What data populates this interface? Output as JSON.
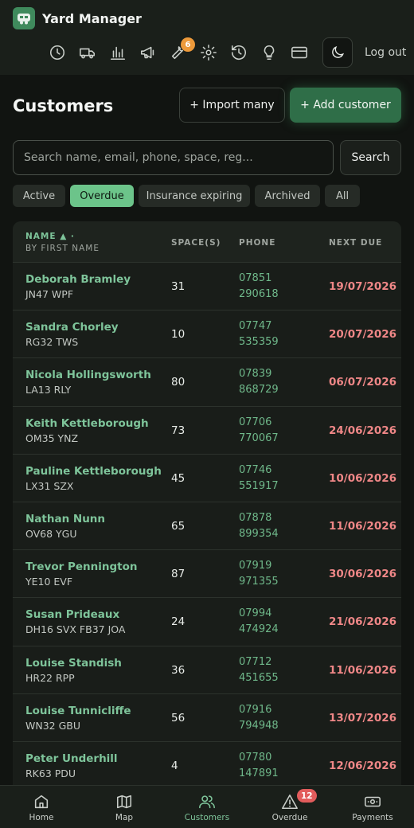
{
  "app": {
    "title": "Yard Manager"
  },
  "toolbar": {
    "icons": [
      "clock-icon",
      "truck-icon",
      "bar-chart-icon",
      "megaphone-icon",
      "wrench-icon",
      "gear-icon",
      "history-icon",
      "lightbulb-icon",
      "card-icon"
    ],
    "maintenance_badge": "6",
    "theme_icon": "moon-icon",
    "logout_label": "Log out"
  },
  "page": {
    "title": "Customers",
    "import_label": "+ Import many",
    "add_label": "+ Add customer"
  },
  "search": {
    "placeholder": "Search name, email, phone, space, reg...",
    "value": "",
    "button_label": "Search"
  },
  "filters": [
    {
      "label": "Active",
      "active": false
    },
    {
      "label": "Overdue",
      "active": true
    },
    {
      "label": "Insurance expiring",
      "active": false
    },
    {
      "label": "Archived",
      "active": false
    },
    {
      "label": "All",
      "active": false
    }
  ],
  "table": {
    "headers": {
      "name": "NAME ▲ ·",
      "name_sub": "BY FIRST NAME",
      "spaces": "SPACE(S)",
      "phone": "PHONE",
      "next_due": "NEXT DUE"
    },
    "rows": [
      {
        "name": "Deborah Bramley",
        "reg": "JN47 WPF",
        "space": "31",
        "phone1": "07851",
        "phone2": "290618",
        "due": "19/07/2026"
      },
      {
        "name": "Sandra Chorley",
        "reg": "RG32 TWS",
        "space": "10",
        "phone1": "07747",
        "phone2": "535359",
        "due": "20/07/2026"
      },
      {
        "name": "Nicola Hollingsworth",
        "reg": "LA13 RLY",
        "space": "80",
        "phone1": "07839",
        "phone2": "868729",
        "due": "06/07/2026"
      },
      {
        "name": "Keith Kettleborough",
        "reg": "OM35 YNZ",
        "space": "73",
        "phone1": "07706",
        "phone2": "770067",
        "due": "24/06/2026"
      },
      {
        "name": "Pauline Kettleborough",
        "reg": "LX31 SZX",
        "space": "45",
        "phone1": "07746",
        "phone2": "551917",
        "due": "10/06/2026"
      },
      {
        "name": "Nathan Nunn",
        "reg": "OV68 YGU",
        "space": "65",
        "phone1": "07878",
        "phone2": "899354",
        "due": "11/06/2026"
      },
      {
        "name": "Trevor Pennington",
        "reg": "YE10 EVF",
        "space": "87",
        "phone1": "07919",
        "phone2": "971355",
        "due": "30/06/2026"
      },
      {
        "name": "Susan Prideaux",
        "reg": "DH16 SVX FB37 JOA",
        "space": "24",
        "phone1": "07994",
        "phone2": "474924",
        "due": "21/06/2026"
      },
      {
        "name": "Louise Standish",
        "reg": "HR22 RPP",
        "space": "36",
        "phone1": "07712",
        "phone2": "451655",
        "due": "11/06/2026"
      },
      {
        "name": "Louise Tunnicliffe",
        "reg": "WN32 GBU",
        "space": "56",
        "phone1": "07916",
        "phone2": "794948",
        "due": "13/07/2026"
      },
      {
        "name": "Peter Underhill",
        "reg": "RK63 PDU",
        "space": "4",
        "phone1": "07780",
        "phone2": "147891",
        "due": "12/06/2026"
      }
    ]
  },
  "bottom_nav": [
    {
      "label": "Home",
      "icon": "home-icon",
      "active": false
    },
    {
      "label": "Map",
      "icon": "map-icon",
      "active": false
    },
    {
      "label": "Customers",
      "icon": "users-icon",
      "active": true
    },
    {
      "label": "Overdue",
      "icon": "warning-icon",
      "active": false,
      "badge": "12"
    },
    {
      "label": "Payments",
      "icon": "cash-icon",
      "active": false
    }
  ],
  "colors": {
    "accent": "#6cc48a",
    "primary_button": "#2f6e48",
    "overdue_text": "#ef8787",
    "badge_orange": "#ee9a3a",
    "badge_red": "#e25c5c"
  }
}
